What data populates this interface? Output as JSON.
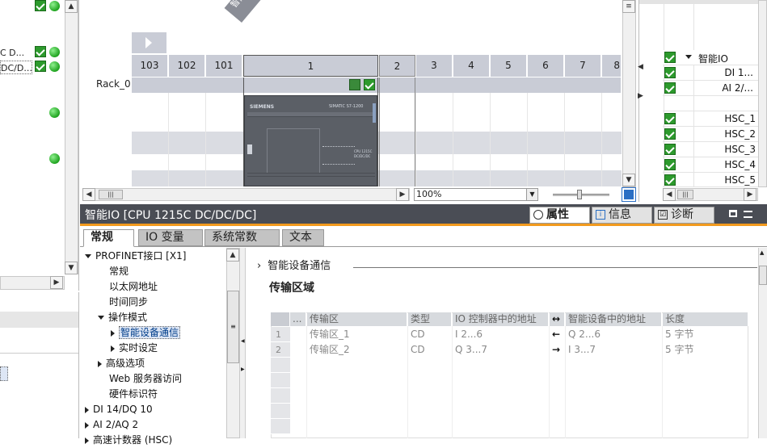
{
  "left_panel": {
    "items": [
      {
        "label": "C D..."
      },
      {
        "label": "DC/D..."
      }
    ]
  },
  "device_view": {
    "device_tag": "智能IO",
    "rack_label": "Rack_0",
    "slots": [
      "103",
      "102",
      "101",
      "1",
      "2",
      "3",
      "4",
      "5",
      "6",
      "7",
      "8"
    ],
    "zoom": "100%",
    "cpu_brand": "SIEMENS",
    "cpu_model": "SIMATIC S7-1200",
    "cpu_side_label": "CPU 1215C DC/DC/DC"
  },
  "right_overview": {
    "rows": [
      {
        "label": "智能IO",
        "checked": true,
        "expand": true
      },
      {
        "label": "DI 1...",
        "checked": true
      },
      {
        "label": "AI 2/...",
        "checked": true
      },
      {
        "label": "",
        "checked": false
      },
      {
        "label": "HSC_1",
        "checked": true
      },
      {
        "label": "HSC_2",
        "checked": true
      },
      {
        "label": "HSC_3",
        "checked": true
      },
      {
        "label": "HSC_4",
        "checked": true
      },
      {
        "label": "HSC_5",
        "checked": true
      }
    ]
  },
  "inspector": {
    "title": "智能IO [CPU 1215C DC/DC/DC]",
    "top_tabs": {
      "properties": "属性",
      "info": "信息",
      "diagnostics": "诊断"
    },
    "tabs": [
      "常规",
      "IO 变量",
      "系统常数",
      "文本"
    ],
    "tree": {
      "profinet": "PROFINET接口 [X1]",
      "general": "常规",
      "ethernet": "以太网地址",
      "time_sync": "时间同步",
      "op_mode": "操作模式",
      "idev_comm": "智能设备通信",
      "realtime": "实时设定",
      "advanced": "高级选项",
      "web": "Web 服务器访问",
      "hw_id": "硬件标识符",
      "di": "DI 14/DQ 10",
      "ai": "AI 2/AQ 2",
      "hsc": "高速计数器 (HSC)"
    },
    "section_label": "智能设备通信",
    "section_title": "传输区域",
    "table": {
      "headers": [
        "...",
        "传输区",
        "类型",
        "IO 控制器中的地址",
        "↔",
        "智能设备中的地址",
        "长度"
      ],
      "rows": [
        {
          "num": "1",
          "name": "传输区_1",
          "type": "CD",
          "ctrl_addr": "I 2...6",
          "dir": "←",
          "dev_addr": "Q 2...6",
          "len": "5 字节"
        },
        {
          "num": "2",
          "name": "传输区_2",
          "type": "CD",
          "ctrl_addr": "Q 3...7",
          "dir": "→",
          "dev_addr": "I 3...7",
          "len": "5 字节"
        }
      ]
    }
  },
  "colors": {
    "accent_orange": "#f29a1e",
    "panel_dark": "#4a4d55",
    "check_green": "#2d9a2d"
  }
}
